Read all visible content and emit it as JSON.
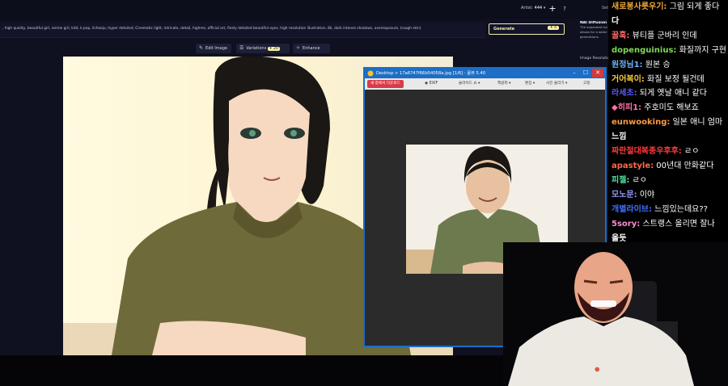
{
  "topbar": {
    "artist_label": "Artist:",
    "artist_count": "444",
    "artist_suffix": "▾",
    "add_icon": "+",
    "help_icon": "?",
    "settings_tab": "Set"
  },
  "prompt": {
    "text": ", high quality, beautiful girl, anime girl, kitd, k-pop, lichaeju, hyper detailed, Cinematic light, intricate, detail, highres, official art, finely detailed beautiful eyes, high resolution illustration, 8k, dark intense shadows, overexposure, (rough skin)"
  },
  "generate": {
    "label": "Generate",
    "cost": "✦ 4"
  },
  "side_panel": {
    "title": "NAI Diffusion A",
    "body_lines": [
      "The expanded tra",
      "allows for a wider",
      "generations."
    ],
    "resolution_label": "Image Resolution"
  },
  "tools": {
    "edit_image": "Edit Image",
    "variations": "Variations",
    "variations_cost": "✦ 20",
    "enhance": "Enhance"
  },
  "viewer": {
    "title": "Desktop  >  17a6747f66b54058a.jpg  [1/6] - 꿀뷰 5.40",
    "new_window": "새 창에서 다운로드",
    "exif": "EXIF",
    "menus": [
      "슬라이드 쇼 ▾",
      "책갈피 ▾",
      "편집 ▾",
      "사진 올리기 ▾",
      "고정"
    ],
    "min_icon": "–",
    "max_icon": "☐",
    "close_icon": "✕"
  },
  "chat": {
    "messages": [
      {
        "user": "새로봉사릇우기:",
        "text": " 그림 되게 좋다",
        "color": "#f2a93b"
      },
      {
        "user": "다",
        "text": "",
        "color": "#ffffff"
      },
      {
        "user": "꿀혹:",
        "text": " 뷰티플 군바리 인데",
        "color": "#ff6a6a"
      },
      {
        "user": "dopenguinius:",
        "text": " 화질까지 구현",
        "color": "#7fd858"
      },
      {
        "user": "원정님1:",
        "text": " 원본 승",
        "color": "#6fb3ff"
      },
      {
        "user": "거어복이:",
        "text": " 화질 보정 될건데",
        "color": "#f6cc3f"
      },
      {
        "user": "라세초:",
        "text": " 되게 옛날 애니 같다",
        "color": "#5b5bff"
      },
      {
        "user": "◆히피1:",
        "text": " 주호미도 해보죠",
        "color": "#ff6fa8"
      },
      {
        "user": "eunwooking:",
        "text": " 일본 애니 엄마",
        "color": "#ff9b42"
      },
      {
        "user": "느낌",
        "text": "",
        "color": "#ffffff"
      },
      {
        "user": "짜란절대복종우후후:",
        "text": " ㄹㅇ",
        "color": "#ff3b3b"
      },
      {
        "user": "apastyle:",
        "text": " 00년대 만화같다",
        "color": "#ff6a4a"
      },
      {
        "user": "피젤:",
        "text": " ㄹㅇ",
        "color": "#4fe0a0"
      },
      {
        "user": "모노문:",
        "text": " 이야",
        "color": "#9a9aff"
      },
      {
        "user": "개별라이브:",
        "text": " 느낌있는데요??",
        "color": "#3f6fff"
      },
      {
        "user": "5sory:",
        "text": " 스트랭스 올리면 잘나",
        "color": "#ff8bd0"
      },
      {
        "user": "올듯",
        "text": "",
        "color": "#ffffff"
      }
    ]
  },
  "colors": {
    "accent": "#f5f1a6",
    "viewer_title": "#1d6ec4",
    "app_bg": "#0f1020"
  }
}
